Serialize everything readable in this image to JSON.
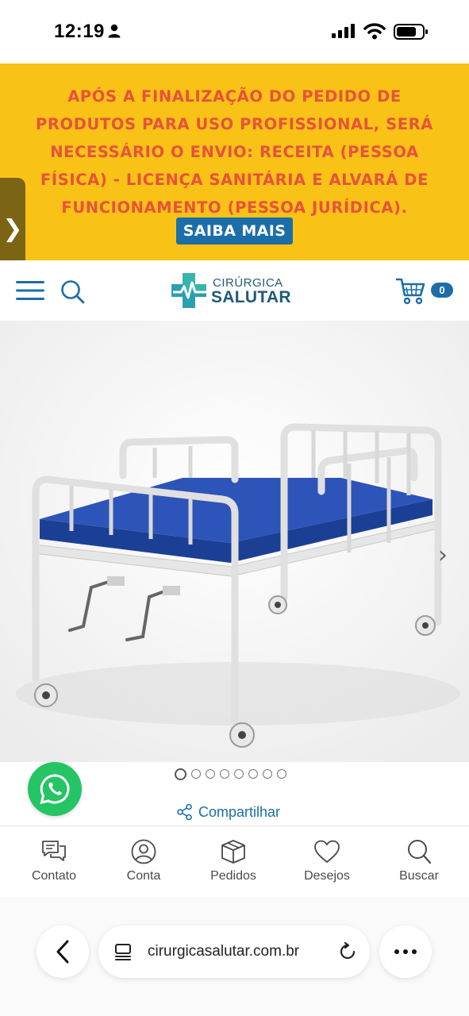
{
  "status_bar": {
    "time": "12:19"
  },
  "banner": {
    "notice": "APÓS A FINALIZAÇÃO DO PEDIDO DE PRODUTOS PARA USO PROFISSIONAL, SERÁ NECESSÁRIO O ENVIO: RECEITA (PESSOA FÍSICA) - LICENÇA SANITÁRIA E ALVARÁ DE FUNCIONAMENTO (PESSOA JURÍDICA).",
    "button_label": "SAIBA MAIS",
    "side_tab_glyph": "❯",
    "background_color": "#f8c217",
    "text_color": "#e8523a",
    "button_color": "#1c6ea8"
  },
  "header": {
    "logo_top": "CIRÚRGICA",
    "logo_bottom": "SALUTAR",
    "cart_count": "0",
    "icons": [
      "menu-icon",
      "search-icon",
      "cart-icon"
    ]
  },
  "gallery": {
    "image_alt": "Cama hospitalar manual com colchão azul",
    "next_glyph": "›",
    "slide_count": 8,
    "active_slide": 1
  },
  "share": {
    "label": "Compartilhar"
  },
  "bottom_nav": {
    "items": [
      {
        "label": "Contato",
        "icon": "chat-icon"
      },
      {
        "label": "Conta",
        "icon": "user-icon"
      },
      {
        "label": "Pedidos",
        "icon": "box-icon"
      },
      {
        "label": "Desejos",
        "icon": "heart-icon"
      },
      {
        "label": "Buscar",
        "icon": "search-icon"
      }
    ]
  },
  "browser": {
    "url": "cirurgicasalutar.com.br"
  }
}
